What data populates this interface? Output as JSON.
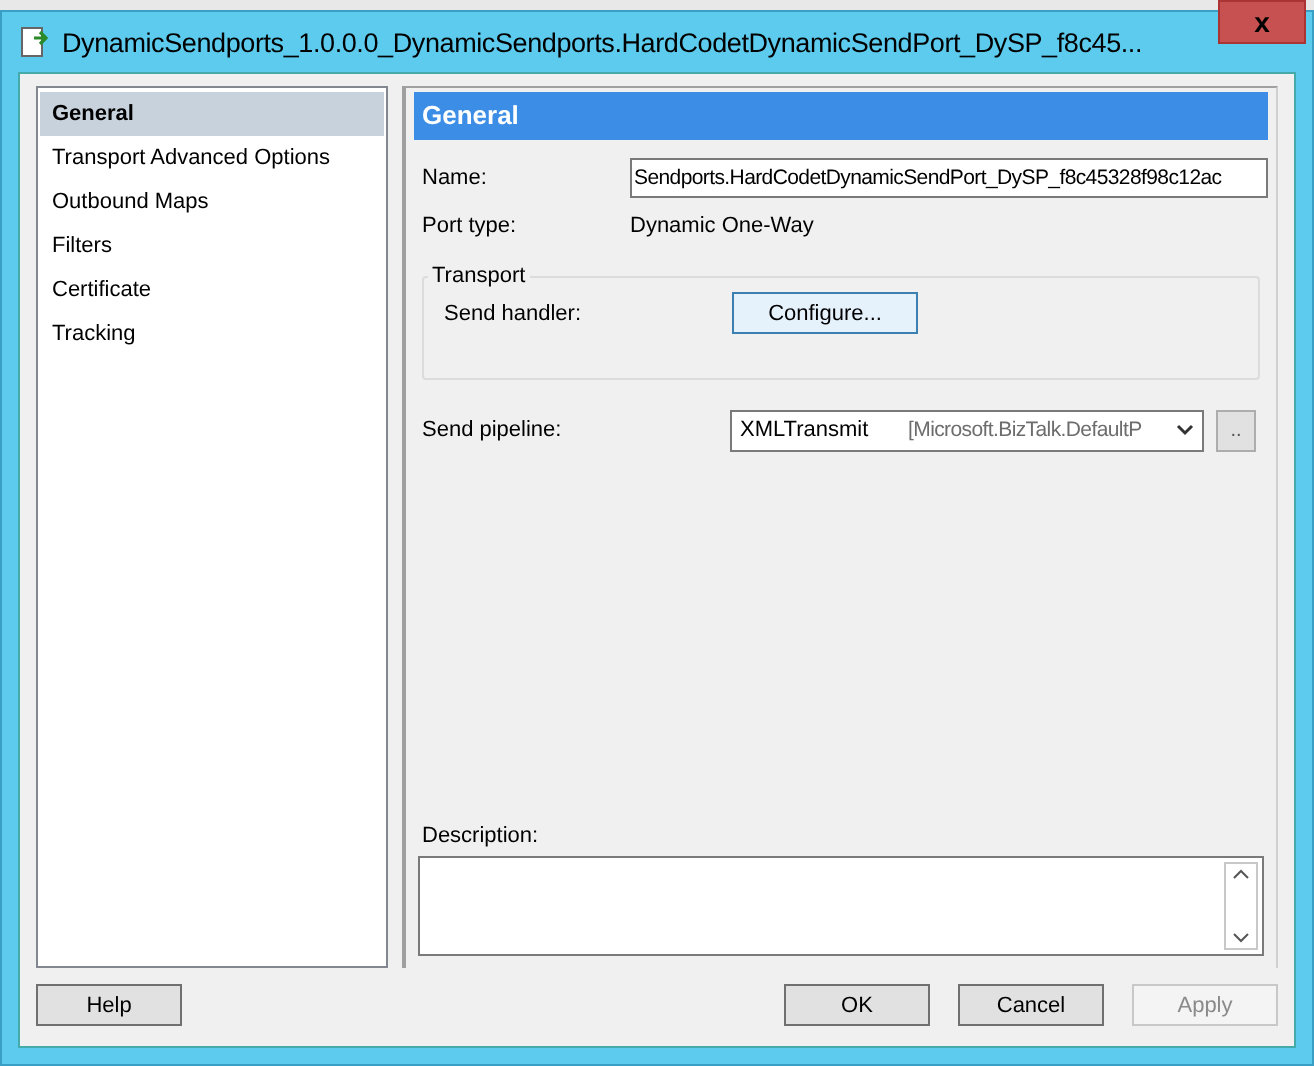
{
  "window": {
    "title": "DynamicSendports_1.0.0.0_DynamicSendports.HardCodetDynamicSendPort_DySP_f8c45...",
    "close": "x"
  },
  "sidebar": {
    "items": [
      {
        "label": "General",
        "selected": true
      },
      {
        "label": "Transport Advanced Options",
        "selected": false
      },
      {
        "label": "Outbound Maps",
        "selected": false
      },
      {
        "label": "Filters",
        "selected": false
      },
      {
        "label": "Certificate",
        "selected": false
      },
      {
        "label": "Tracking",
        "selected": false
      }
    ]
  },
  "panel": {
    "header": "General",
    "name": {
      "label": "Name:",
      "value": "Sendports.HardCodetDynamicSendPort_DySP_f8c45328f98c12ac"
    },
    "port_type": {
      "label": "Port type:",
      "value": "Dynamic One-Way"
    },
    "transport": {
      "title": "Transport",
      "send_handler_label": "Send handler:",
      "configure_button": "Configure..."
    },
    "send_pipeline": {
      "label": "Send pipeline:",
      "value": "XMLTransmit",
      "detail": "[Microsoft.BizTalk.DefaultP",
      "browse_button": ".."
    },
    "description": {
      "label": "Description:"
    }
  },
  "buttons": [
    {
      "label": "Help",
      "disabled": false
    },
    {
      "label": "OK",
      "disabled": false
    },
    {
      "label": "Cancel",
      "disabled": false
    },
    {
      "label": "Apply",
      "disabled": true
    }
  ]
}
